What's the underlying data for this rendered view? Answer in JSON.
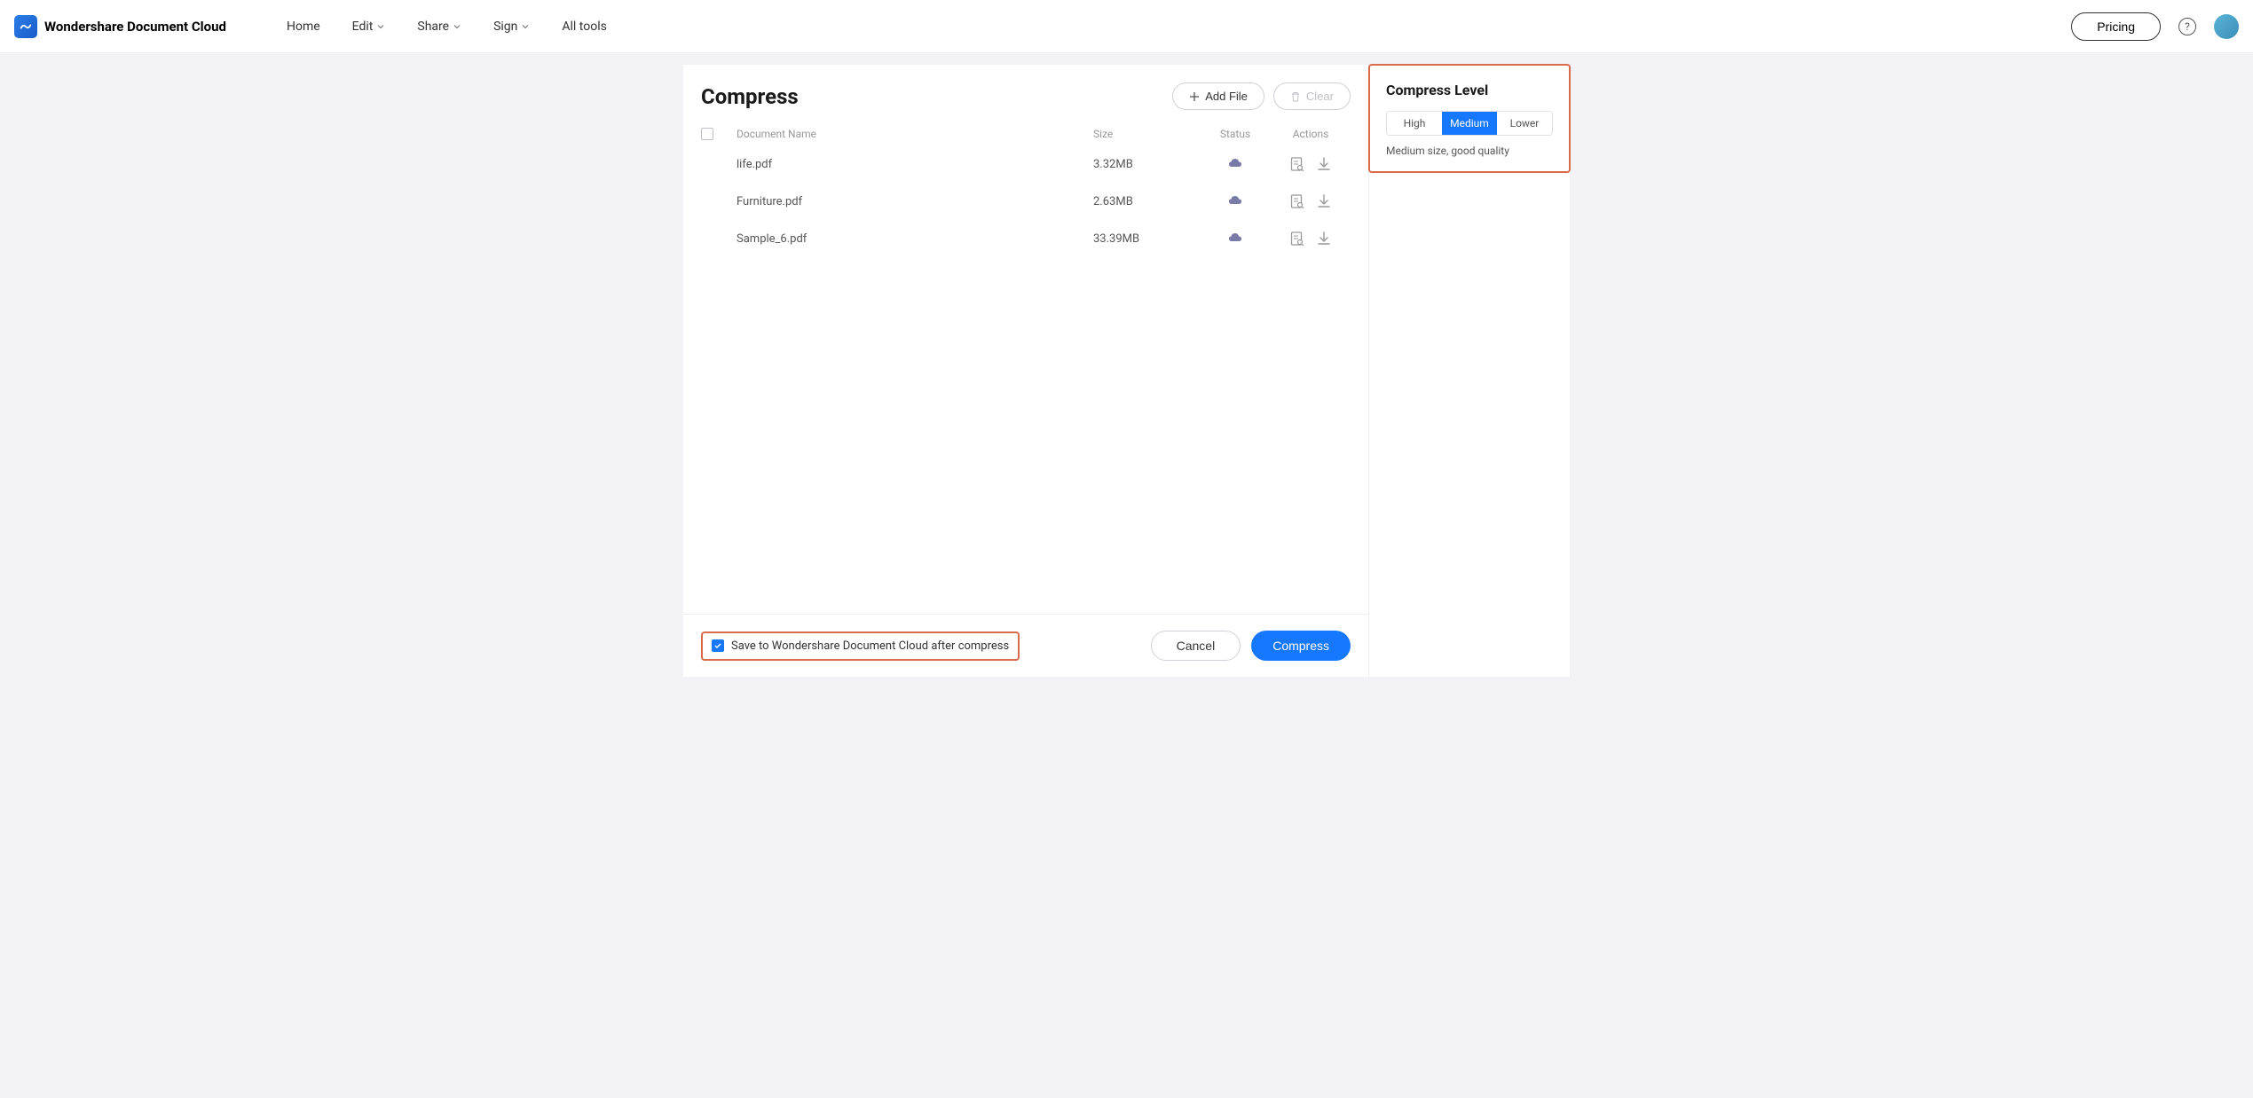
{
  "header": {
    "logo_text": "Wondershare Document Cloud",
    "nav": {
      "home": "Home",
      "edit": "Edit",
      "share": "Share",
      "sign": "Sign",
      "all_tools": "All tools"
    },
    "pricing": "Pricing"
  },
  "page": {
    "title": "Compress",
    "add_file": "Add File",
    "clear": "Clear"
  },
  "table": {
    "headers": {
      "name": "Document Name",
      "size": "Size",
      "status": "Status",
      "actions": "Actions"
    },
    "rows": [
      {
        "name": "life.pdf",
        "size": "3.32MB"
      },
      {
        "name": "Furniture.pdf",
        "size": "2.63MB"
      },
      {
        "name": "Sample_6.pdf",
        "size": "33.39MB"
      }
    ]
  },
  "footer": {
    "save_label": "Save to Wondershare Document Cloud after compress",
    "cancel": "Cancel",
    "compress": "Compress"
  },
  "side": {
    "title": "Compress Level",
    "high": "High",
    "medium": "Medium",
    "lower": "Lower",
    "desc": "Medium size, good quality"
  }
}
